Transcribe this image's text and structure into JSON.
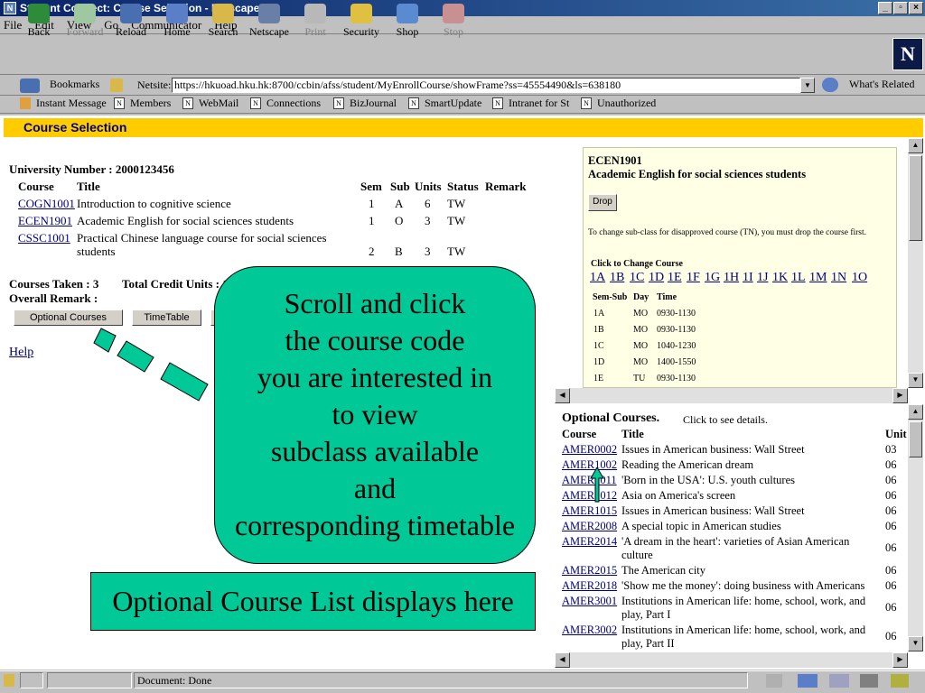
{
  "window": {
    "title": "Student Connect: Course Selection - Netscape"
  },
  "menu": [
    "File",
    "Edit",
    "View",
    "Go",
    "Communicator",
    "Help"
  ],
  "toolbar": [
    {
      "label": "Back",
      "icon": "back-arrow-icon",
      "enabled": true
    },
    {
      "label": "Forward",
      "icon": "forward-arrow-icon",
      "enabled": false
    },
    {
      "label": "Reload",
      "icon": "reload-icon",
      "enabled": true
    },
    {
      "label": "Home",
      "icon": "home-icon",
      "enabled": true
    },
    {
      "label": "Search",
      "icon": "search-icon",
      "enabled": true
    },
    {
      "label": "Netscape",
      "icon": "netscape-icon",
      "enabled": true
    },
    {
      "label": "Print",
      "icon": "print-icon",
      "enabled": false
    },
    {
      "label": "Security",
      "icon": "lock-icon",
      "enabled": true
    },
    {
      "label": "Shop",
      "icon": "shop-icon",
      "enabled": true
    },
    {
      "label": "Stop",
      "icon": "stop-icon",
      "enabled": false
    }
  ],
  "location": {
    "bookmarks": "Bookmarks",
    "netsite_label": "Netsite:",
    "url": "https://hkuoad.hku.hk:8700/ccbin/afss/student/MyEnrollCourse/showFrame?ss=45554490&ls=638180",
    "related": "What's Related"
  },
  "personal": [
    "Instant Message",
    "Members",
    "WebMail",
    "Connections",
    "BizJournal",
    "SmartUpdate",
    "Intranet for St",
    "Unauthorized"
  ],
  "page": {
    "banner": "Course Selection",
    "university_number_label": "University Number :",
    "university_number": "2000123456",
    "headers": {
      "course": "Course",
      "title": "Title",
      "sem": "Sem",
      "sub": "Sub",
      "units": "Units",
      "status": "Status",
      "remark": "Remark"
    },
    "courses": [
      {
        "code": "COGN1001",
        "title": "Introduction to cognitive science",
        "title2": "",
        "sem": "1",
        "sub": "A",
        "units": "6",
        "status": "TW"
      },
      {
        "code": "ECEN1901",
        "title": "Academic English for social sciences students",
        "title2": "",
        "sem": "1",
        "sub": "O",
        "units": "3",
        "status": "TW"
      },
      {
        "code": "CSSC1001",
        "title": "Practical Chinese language course for social sciences",
        "title2": "students",
        "sem": "2",
        "sub": "B",
        "units": "3",
        "status": "TW"
      }
    ],
    "courses_taken": "Courses Taken : 3",
    "total_credit": "Total Credit Units : 12",
    "overall_remark": "Overall Remark :",
    "buttons": {
      "optional": "Optional Courses",
      "timetable": "TimeTable"
    },
    "help": "Help"
  },
  "detail": {
    "code": "ECEN1901",
    "title": "Academic English for social sciences students",
    "drop": "Drop",
    "note": "To change sub-class for disapproved course (TN), you must drop the course first.",
    "change_label": "Click to Change Course",
    "subclasses": [
      "1A",
      "1B",
      "1C",
      "1D",
      "1E",
      "1F",
      "1G",
      "1H",
      "1I",
      "1J",
      "1K",
      "1L",
      "1M",
      "1N",
      "1O"
    ],
    "sched_headers": {
      "semsub": "Sem-Sub",
      "day": "Day",
      "time": "Time"
    },
    "schedule": [
      {
        "semsub": "1A",
        "day": "MO",
        "time": "0930-1130"
      },
      {
        "semsub": "1B",
        "day": "MO",
        "time": "0930-1130"
      },
      {
        "semsub": "1C",
        "day": "MO",
        "time": "1040-1230"
      },
      {
        "semsub": "1D",
        "day": "MO",
        "time": "1400-1550"
      },
      {
        "semsub": "1E",
        "day": "TU",
        "time": "0930-1130"
      }
    ]
  },
  "optional": {
    "heading": "Optional Courses.",
    "hint": "Click to see details.",
    "headers": {
      "course": "Course",
      "title": "Title",
      "units": "Unit"
    },
    "rows": [
      {
        "code": "AMER0002",
        "title": "Issues in American business: Wall Street",
        "title2": "",
        "units": "03"
      },
      {
        "code": "AMER1002",
        "title": "Reading the American dream",
        "title2": "",
        "units": "06"
      },
      {
        "code": "AMER1011",
        "title": "'Born in the USA': U.S. youth cultures",
        "title2": "",
        "units": "06"
      },
      {
        "code": "AMER1012",
        "title": "Asia on America's screen",
        "title2": "",
        "units": "06"
      },
      {
        "code": "AMER1015",
        "title": "Issues in American business: Wall Street",
        "title2": "",
        "units": "06"
      },
      {
        "code": "AMER2008",
        "title": "A special topic in American studies",
        "title2": "",
        "units": "06"
      },
      {
        "code": "AMER2014",
        "title": "'A dream in the heart': varieties of Asian American",
        "title2": "culture",
        "units": "06"
      },
      {
        "code": "AMER2015",
        "title": "The American city",
        "title2": "",
        "units": "06"
      },
      {
        "code": "AMER2018",
        "title": "'Show me the money': doing business with Americans",
        "title2": "",
        "units": "06"
      },
      {
        "code": "AMER3001",
        "title": "Institutions in American life: home, school, work, and",
        "title2": "play, Part I",
        "units": "06"
      },
      {
        "code": "AMER3002",
        "title": "Institutions in American life: home, school, work, and",
        "title2": "play, Part II",
        "units": "06"
      }
    ]
  },
  "status": {
    "text": "Document: Done"
  },
  "overlay": {
    "callout_lines": [
      "Scroll and click",
      "the course code",
      "you are interested in",
      "to view",
      "subclass available",
      "and",
      "corresponding timetable"
    ],
    "note": "Optional Course List displays here"
  }
}
